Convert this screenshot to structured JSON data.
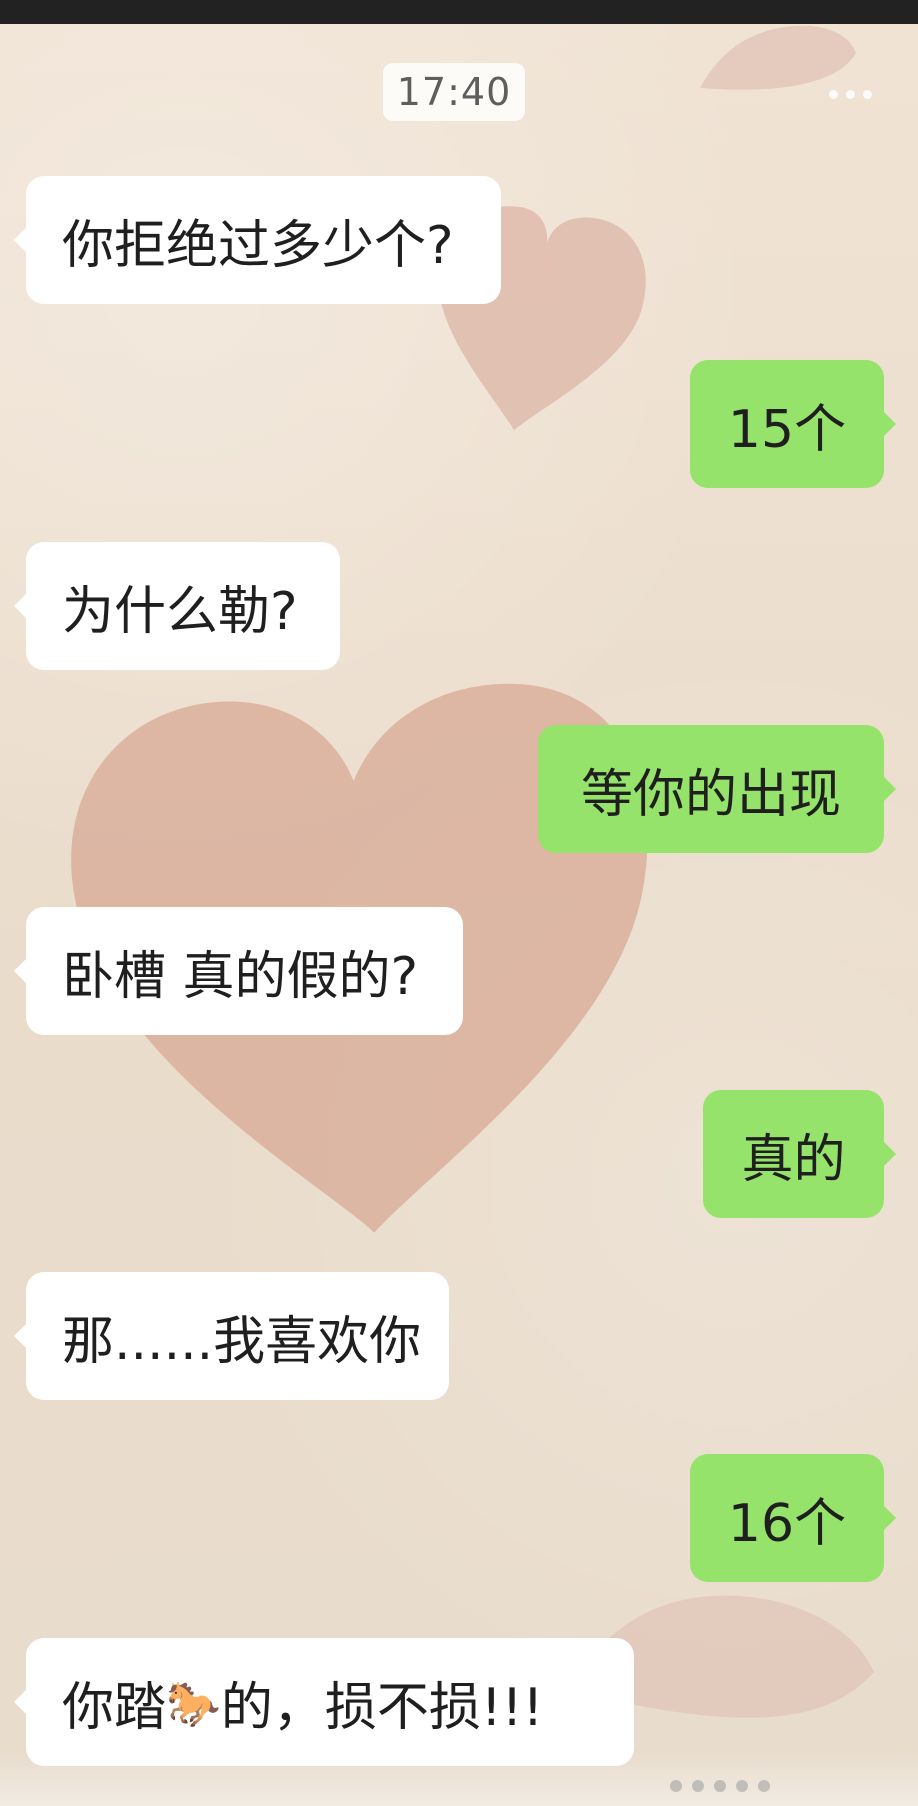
{
  "timestamp": "17:40",
  "messages": [
    {
      "side": "left",
      "text": "你拒绝过多少个?"
    },
    {
      "side": "right",
      "text": "15个"
    },
    {
      "side": "left",
      "text": "为什么勒?"
    },
    {
      "side": "right",
      "text": "等你的出现"
    },
    {
      "side": "left",
      "text": "卧槽 真的假的?"
    },
    {
      "side": "right",
      "text": "真的"
    },
    {
      "side": "left",
      "text": "那......我喜欢你"
    },
    {
      "side": "right",
      "text": "16个"
    },
    {
      "side": "left",
      "text_before": "你踏",
      "emoji": "🐎",
      "text_after": "的，损不损!!!"
    }
  ],
  "icons": {
    "more": "more-dots-icon"
  }
}
